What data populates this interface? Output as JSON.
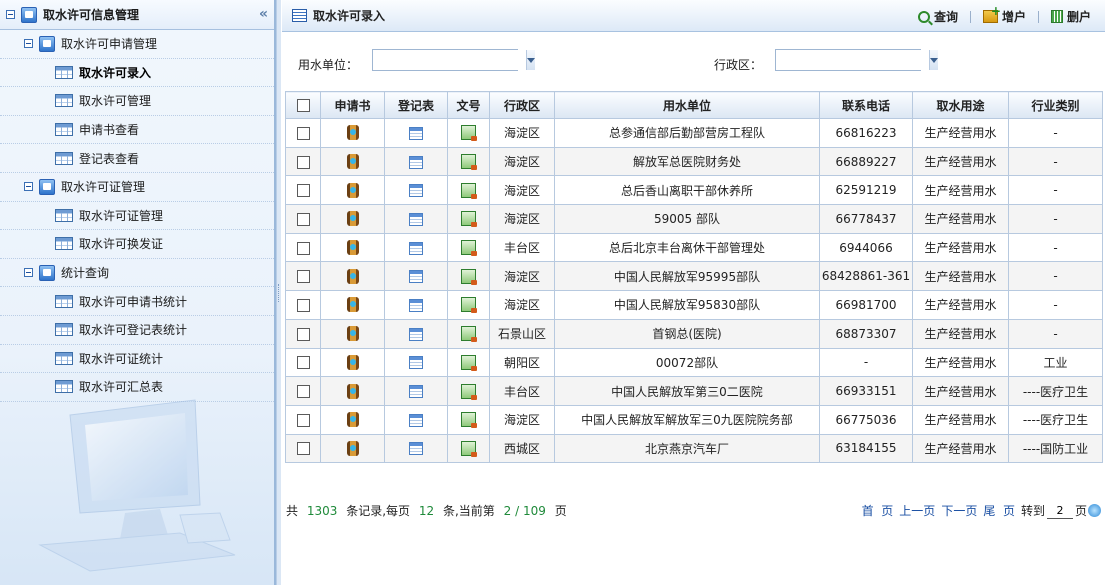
{
  "sidebar": {
    "title": "取水许可信息管理",
    "collapse": "«",
    "groups": [
      {
        "label": "取水许可申请管理",
        "items": [
          "取水许可录入",
          "取水许可管理",
          "申请书查看",
          "登记表查看"
        ]
      },
      {
        "label": "取水许可证管理",
        "items": [
          "取水许可证管理",
          "取水许可换发证"
        ]
      },
      {
        "label": "统计查询",
        "items": [
          "取水许可申请书统计",
          "取水许可登记表统计",
          "取水许可证统计",
          "取水许可汇总表"
        ]
      }
    ]
  },
  "main": {
    "title": "取水许可录入",
    "toolbar": {
      "query": "查询",
      "add": "增户",
      "delete": "删户"
    },
    "filters": {
      "unit_label": "用水单位：",
      "unit_value": "",
      "district_label": "行政区：",
      "district_value": ""
    },
    "columns": [
      "申请书",
      "登记表",
      "文号",
      "行政区",
      "用水单位",
      "联系电话",
      "取水用途",
      "行业类别"
    ],
    "rows": [
      {
        "district": "海淀区",
        "unit": "总参通信部后勤部营房工程队",
        "phone": "66816223",
        "use": "生产经营用水",
        "industry": "-"
      },
      {
        "district": "海淀区",
        "unit": "解放军总医院财务处",
        "phone": "66889227",
        "use": "生产经营用水",
        "industry": "-"
      },
      {
        "district": "海淀区",
        "unit": "总后香山离职干部休养所",
        "phone": "62591219",
        "use": "生产经营用水",
        "industry": "-"
      },
      {
        "district": "海淀区",
        "unit": "59005 部队",
        "phone": "66778437",
        "use": "生产经营用水",
        "industry": "-"
      },
      {
        "district": "丰台区",
        "unit": "总后北京丰台离休干部管理处",
        "phone": "6944066",
        "use": "生产经营用水",
        "industry": "-"
      },
      {
        "district": "海淀区",
        "unit": "中国人民解放军95995部队",
        "phone": "68428861-361",
        "use": "生产经营用水",
        "industry": "-"
      },
      {
        "district": "海淀区",
        "unit": "中国人民解放军95830部队",
        "phone": "66981700",
        "use": "生产经营用水",
        "industry": "-"
      },
      {
        "district": "石景山区",
        "unit": "首钢总(医院)",
        "phone": "68873307",
        "use": "生产经营用水",
        "industry": "-"
      },
      {
        "district": "朝阳区",
        "unit": "00072部队",
        "phone": "-",
        "use": "生产经营用水",
        "industry": "工业"
      },
      {
        "district": "丰台区",
        "unit": "中国人民解放军第三0二医院",
        "phone": "66933151",
        "use": "生产经营用水",
        "industry": "----医疗卫生"
      },
      {
        "district": "海淀区",
        "unit": "中国人民解放军解放军三0九医院院务部",
        "phone": "66775036",
        "use": "生产经营用水",
        "industry": "----医疗卫生"
      },
      {
        "district": "西城区",
        "unit": "北京燕京汽车厂",
        "phone": "63184155",
        "use": "生产经营用水",
        "industry": "----国防工业"
      }
    ],
    "pager": {
      "prefix": "共",
      "total": "1303",
      "per_page_text": "条记录,每页",
      "per_page": "12",
      "current_text": "条,当前第",
      "current": "2 / 109",
      "suffix": "页",
      "first": "首  页",
      "prev": "上一页",
      "next": "下一页",
      "last": "尾  页",
      "goto_label": "转到",
      "goto_value": "2",
      "goto_suffix": "页"
    }
  }
}
